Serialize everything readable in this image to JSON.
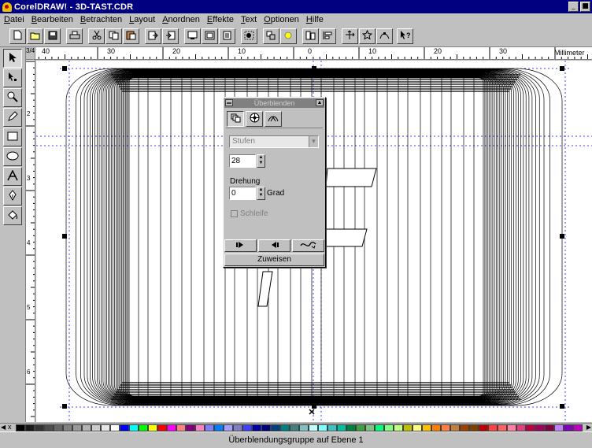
{
  "window": {
    "title": "CorelDRAW! - 3D-TAST.CDR",
    "min_glyph": "_",
    "max_glyph": "■",
    "close_glyph": "x"
  },
  "menu": [
    "Datei",
    "Bearbeiten",
    "Betrachten",
    "Layout",
    "Anordnen",
    "Effekte",
    "Text",
    "Optionen",
    "Hilfe"
  ],
  "toolbar": {
    "buttons": [
      "new-icon",
      "open-icon",
      "save-icon",
      "print-icon",
      "cut-icon",
      "copy-icon",
      "paste-icon",
      "import-icon",
      "export-icon",
      "full-screen-icon",
      "wireframe-icon",
      "zoom-page-icon",
      "group-icon",
      "ungroup-icon",
      "to-front-icon",
      "to-back-icon",
      "align-icon",
      "transform-icon",
      "symbol-icon",
      "node-edit-icon",
      "help-pointer-icon"
    ]
  },
  "ruler": {
    "corner_label": "3/4",
    "units": "Millimeter",
    "h_labels": [
      "40",
      "30",
      "20",
      "10",
      "0",
      "10",
      "20",
      "30"
    ],
    "v_labels": [
      "2",
      "3",
      "4",
      "5",
      "6"
    ]
  },
  "toolbox": [
    "pick-tool-icon",
    "shape-tool-icon",
    "zoom-tool-icon",
    "pencil-tool-icon",
    "rectangle-tool-icon",
    "ellipse-tool-icon",
    "text-tool-icon",
    "outline-pen-tool-icon",
    "fill-tool-icon"
  ],
  "rollup": {
    "title": "Überblenden",
    "tabs": [
      "steps-tab-icon",
      "color-wheel-tab-icon",
      "path-tab-icon"
    ],
    "mode_select": "Stufen",
    "steps_value": "28",
    "rotation_label": "Drehung",
    "rotation_value": "0",
    "rotation_unit": "Grad",
    "loop_label": "Schleife",
    "loop_checked": false,
    "apply_label": "Zuweisen",
    "start_icon": "start-object-icon",
    "end_icon": "end-object-icon",
    "path_icon": "blend-path-icon"
  },
  "status": {
    "text": "Überblendungsgruppe auf Ebene 1"
  },
  "palette": {
    "close_glyph": "x",
    "colors": [
      "#000000",
      "#1a1a1a",
      "#333333",
      "#4d4d4d",
      "#666666",
      "#808080",
      "#999999",
      "#b3b3b3",
      "#cccccc",
      "#e6e6e6",
      "#ffffff",
      "#0000ff",
      "#00ffff",
      "#00ff00",
      "#ffff00",
      "#ff0000",
      "#ff00ff",
      "#ff8080",
      "#800080",
      "#ff80c0",
      "#8080ff",
      "#0080ff",
      "#a0a0ff",
      "#8080c0",
      "#4040ff",
      "#0000a0",
      "#000080",
      "#004080",
      "#008080",
      "#408080",
      "#80c0c0",
      "#c0ffff",
      "#80ffff",
      "#40c0c0",
      "#00c0a0",
      "#008040",
      "#40a040",
      "#80c080",
      "#00ff80",
      "#80ff80",
      "#c0ff80",
      "#c0c000",
      "#ffff80",
      "#ffc000",
      "#ff8000",
      "#ff8040",
      "#c08040",
      "#a04000",
      "#804000",
      "#c00000",
      "#ff4040",
      "#ff6060",
      "#ff80a0",
      "#e04080",
      "#c00040",
      "#a00060",
      "#800040",
      "#c080ff",
      "#8000c0",
      "#c000c0"
    ]
  }
}
